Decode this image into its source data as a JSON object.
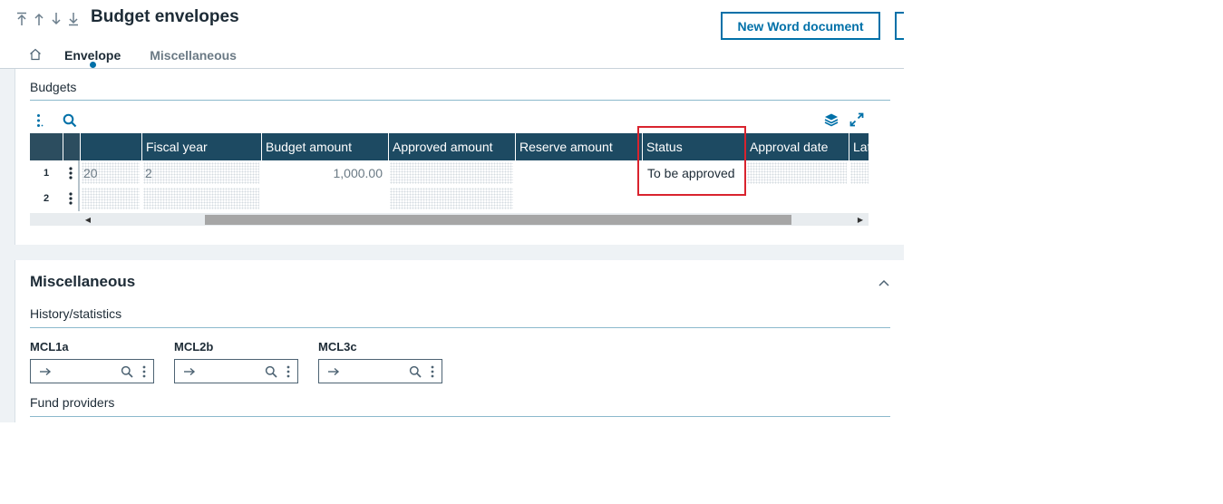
{
  "header": {
    "title": "Budget envelopes",
    "new_word_button": "New Word document",
    "tabs": [
      {
        "label": "Envelope",
        "active": true
      },
      {
        "label": "Miscellaneous",
        "active": false
      }
    ]
  },
  "budgets": {
    "section_label": "Budgets",
    "columns": [
      "Fiscal year",
      "Budget amount",
      "Approved amount",
      "Reserve amount",
      "Status",
      "Approval date",
      "Lat"
    ],
    "rows": [
      {
        "num": "1",
        "first": "20",
        "fiscal_year": "2",
        "budget_amount": "1,000.00",
        "approved_amount": "",
        "reserve_amount": "",
        "status": "To be approved",
        "approval_date": ""
      },
      {
        "num": "2",
        "first": "",
        "fiscal_year": "",
        "budget_amount": "",
        "approved_amount": "",
        "reserve_amount": "",
        "status": "",
        "approval_date": ""
      }
    ]
  },
  "miscellaneous": {
    "title": "Miscellaneous",
    "history_label": "History/statistics",
    "fields": [
      {
        "label": "MCL1a",
        "value": ""
      },
      {
        "label": "MCL2b",
        "value": ""
      },
      {
        "label": "MCL3c",
        "value": ""
      }
    ],
    "fund_providers_label": "Fund providers"
  },
  "colors": {
    "accent": "#0070a8",
    "table_header": "#1d4a62",
    "highlight": "#d9232e"
  },
  "icons": [
    "move-first-icon",
    "move-up-icon",
    "move-down-icon",
    "move-last-icon",
    "home-icon",
    "more-vertical-icon",
    "search-icon",
    "layers-icon",
    "expand-icon",
    "chevron-up-icon",
    "arrow-right-icon"
  ]
}
